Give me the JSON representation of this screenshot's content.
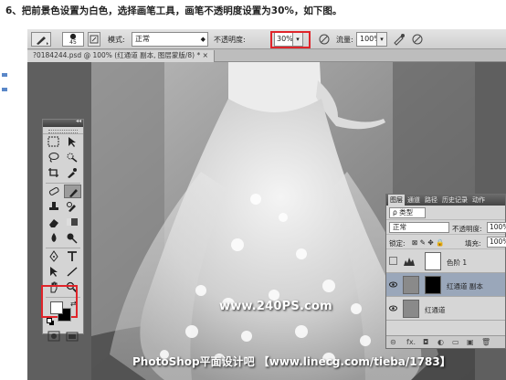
{
  "instruction": "6、把前景色设置为白色，选择画笔工具，画笔不透明度设置为30%，如下图。",
  "options_bar": {
    "brush_size": "45",
    "mode_label": "模式:",
    "mode_value": "正常",
    "opacity_label": "不透明度:",
    "opacity_value": "30%",
    "flow_label": "流量:",
    "flow_value": "100%"
  },
  "document_tab": {
    "title": "?0184244.psd @ 100% (红通道 副本, 图层蒙版/8) * ×"
  },
  "canvas": {
    "watermark": "www.240PS.com",
    "banner": "PhotoShop平面设计吧 【www.linecg.com/tieba/1783】"
  },
  "colors": {
    "foreground": "#ffffff",
    "background": "#000000",
    "highlight": "#e0242a"
  },
  "layers_panel": {
    "tabs": [
      "图层",
      "通道",
      "路径",
      "历史记录",
      "动作"
    ],
    "kind_label": "ρ 类型",
    "blend_mode": "正常",
    "opacity_label": "不透明度:",
    "opacity_value": "100%",
    "lock_label": "锁定:",
    "fill_label": "填充:",
    "fill_value": "100%",
    "layers": [
      {
        "name": "色阶 1",
        "visible": false,
        "type": "adjustment"
      },
      {
        "name": "红通道 副本",
        "visible": true,
        "type": "masked",
        "selected": true
      },
      {
        "name": "红通道",
        "visible": true,
        "type": "normal"
      }
    ],
    "footer_icons": [
      "link-icon",
      "fx-icon",
      "mask-icon",
      "adjustment-icon",
      "folder-icon",
      "new-layer-icon",
      "trash-icon"
    ]
  },
  "toolbar_icons": [
    [
      "marquee-icon",
      "move-icon"
    ],
    [
      "lasso-icon",
      "quick-select-icon"
    ],
    [
      "crop-icon",
      "eyedropper-icon"
    ],
    [
      "healing-icon",
      "brush-icon"
    ],
    [
      "clone-stamp-icon",
      "history-brush-icon"
    ],
    [
      "eraser-icon",
      "gradient-icon"
    ],
    [
      "blur-icon",
      "dodge-icon"
    ],
    [
      "pen-icon",
      "type-icon"
    ],
    [
      "path-select-icon",
      "line-icon"
    ],
    [
      "hand-icon",
      "zoom-icon"
    ]
  ]
}
